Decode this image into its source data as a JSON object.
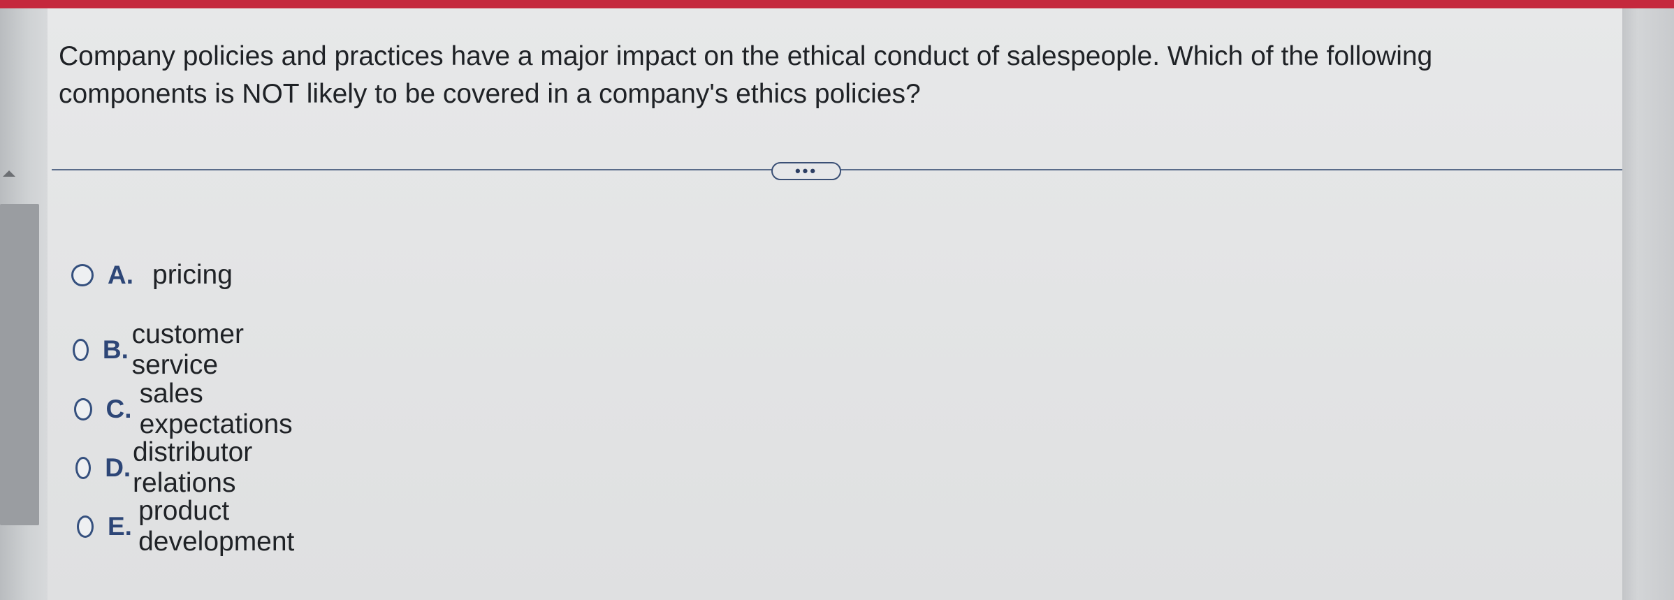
{
  "question": {
    "text": "Company policies and practices have a major impact on the ethical conduct of salespeople. Which of the following components is NOT likely to be covered in a company's ethics policies?"
  },
  "more_button": {
    "label": "•••"
  },
  "options": [
    {
      "letter": "A.",
      "text": "pricing"
    },
    {
      "letter": "B.",
      "text": "customer service"
    },
    {
      "letter": "C.",
      "text": "sales expectations"
    },
    {
      "letter": "D.",
      "text": "distributor relations"
    },
    {
      "letter": "E.",
      "text": "product development"
    }
  ],
  "colors": {
    "top_bar": "#c5283d",
    "accent": "#2d4677",
    "text": "#1f2226"
  }
}
